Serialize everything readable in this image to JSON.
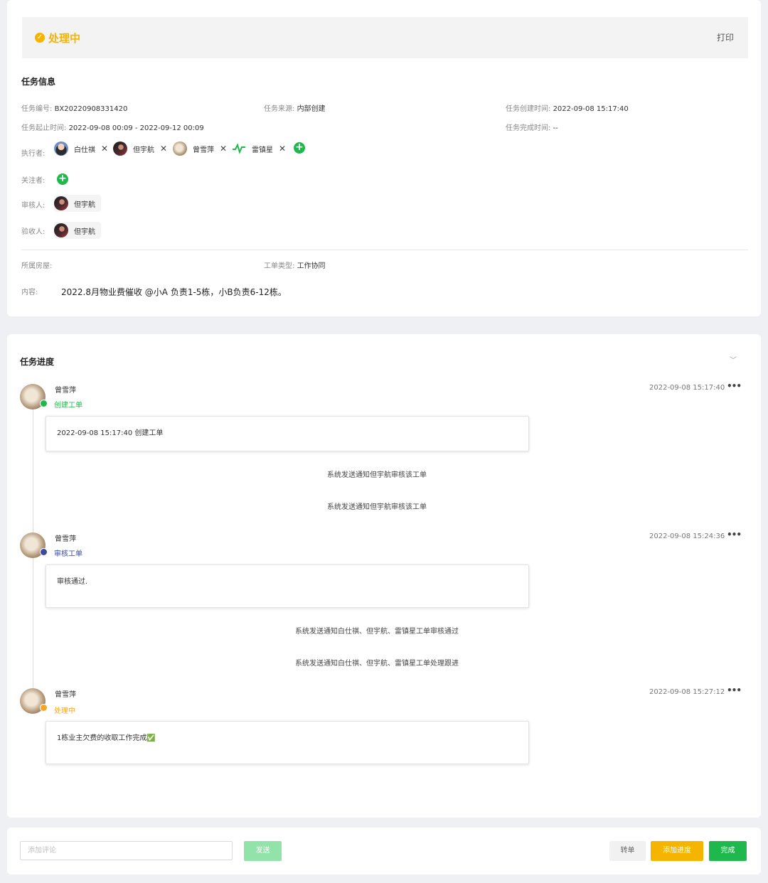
{
  "status": {
    "label": "处理中",
    "print_label": "打印",
    "color": "#f5b400"
  },
  "task_info": {
    "title": "任务信息",
    "id_label": "任务编号:",
    "id_value": "BX20220908331420",
    "source_label": "任务来源:",
    "source_value": "内部创建",
    "created_label": "任务创建时间:",
    "created_value": "2022-09-08 15:17:40",
    "period_label": "任务起止时间:",
    "period_value": "2022-09-08 00:09 - 2022-09-12 00:09",
    "finished_label": "任务完成时间:",
    "finished_value": "--",
    "executors_label": "执行者:",
    "executors": [
      "白仕祺",
      "但宇航",
      "曾雪萍",
      "雷镇星"
    ],
    "followers_label": "关注者:",
    "reviewer_label": "审核人:",
    "reviewer": "但宇航",
    "acceptor_label": "验收人:",
    "acceptor": "但宇航",
    "house_label": "所属房屋:",
    "type_label": "工单类型:",
    "type_value": "工作协同",
    "content_label": "内容:",
    "content_value": "2022.8月物业费催收 @小A 负责1-5栋，小B负责6-12栋。"
  },
  "progress": {
    "title": "任务进度",
    "entries": [
      {
        "name": "曾雪萍",
        "tag": "创建工单",
        "tag_color": "#1fb84c",
        "time": "2022-09-08 15:17:40",
        "content": "2022-09-08 15:17:40 创建工单"
      },
      {
        "name": "曾雪萍",
        "tag": "审核工单",
        "tag_color": "#3b4aa0",
        "time": "2022-09-08 15:24:36",
        "content": "审核通过."
      },
      {
        "name": "曾雪萍",
        "tag": "处理中",
        "tag_color": "#f5a623",
        "time": "2022-09-08 15:27:12",
        "content": "1栋业主欠费的收取工作完成✅"
      }
    ],
    "system_messages": [
      "系统发送通知但宇航审核该工单",
      "系统发送通知但宇航审核该工单",
      "系统发送通知白仕祺、但宇航、雷镇星工单审核通过",
      "系统发送通知白仕祺、但宇航、雷镇星工单处理跟进"
    ]
  },
  "footer": {
    "comment_placeholder": "添加评论",
    "send_label": "发送",
    "transfer_label": "转单",
    "add_progress_label": "添加进度",
    "done_label": "完成"
  }
}
